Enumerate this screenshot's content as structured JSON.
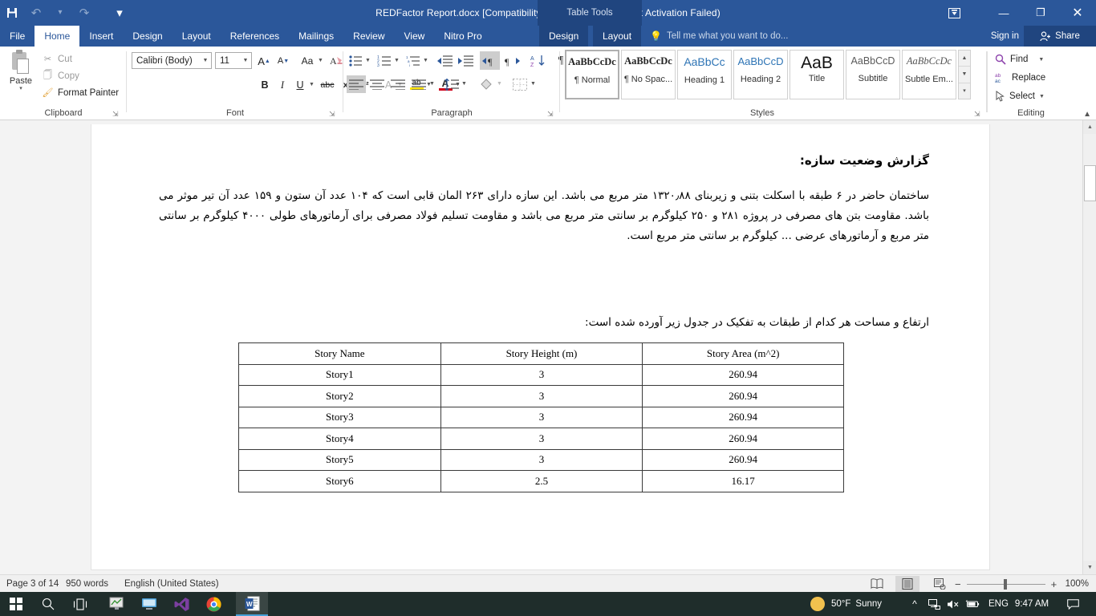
{
  "titlebar": {
    "document_title": "REDFactor Report.docx [Compatibility Mode] - Word (Product Activation Failed)",
    "contextual_tools": "Table Tools",
    "qat": [
      {
        "name": "save",
        "glyph": "💾"
      },
      {
        "name": "undo",
        "glyph": "↶"
      },
      {
        "name": "redo",
        "glyph": "↻"
      },
      {
        "name": "customize-qat",
        "glyph": "▾"
      }
    ],
    "window_controls": [
      {
        "name": "ribbon-display-options",
        "glyph": "⬜"
      },
      {
        "name": "minimize",
        "glyph": "─"
      },
      {
        "name": "restore",
        "glyph": "❐"
      },
      {
        "name": "close",
        "glyph": "✕"
      }
    ]
  },
  "tabs": [
    {
      "label": "File",
      "active": false
    },
    {
      "label": "Home",
      "active": true
    },
    {
      "label": "Insert",
      "active": false
    },
    {
      "label": "Design",
      "active": false
    },
    {
      "label": "Layout",
      "active": false
    },
    {
      "label": "References",
      "active": false
    },
    {
      "label": "Mailings",
      "active": false
    },
    {
      "label": "Review",
      "active": false
    },
    {
      "label": "View",
      "active": false
    },
    {
      "label": "Nitro Pro",
      "active": false
    }
  ],
  "contextual_tabs": [
    {
      "label": "Design"
    },
    {
      "label": "Layout"
    }
  ],
  "tell_me": {
    "placeholder": "Tell me what you want to do...",
    "icon": "lightbulb-icon"
  },
  "account": {
    "sign_in": "Sign in",
    "share": "Share"
  },
  "ribbon": {
    "groups": [
      {
        "name": "Clipboard"
      },
      {
        "name": "Font"
      },
      {
        "name": "Paragraph"
      },
      {
        "name": "Styles"
      },
      {
        "name": "Editing"
      }
    ],
    "clipboard": {
      "paste": "Paste",
      "cut": "Cut",
      "copy": "Copy",
      "format_painter": "Format Painter"
    },
    "font": {
      "font_name": "Calibri (Body)",
      "font_size": "11",
      "grow_font": "A",
      "shrink_font": "A",
      "change_case": "Aa",
      "clear_formatting": "✐",
      "bold": "B",
      "italic": "I",
      "underline": "U",
      "strikethrough": "abc",
      "subscript": "x₂",
      "superscript": "x²",
      "text_effects": "A",
      "highlight": "ab",
      "font_color": "A"
    },
    "paragraph": {
      "bullets": "☰",
      "numbering": "☰",
      "multilevel": "☰",
      "decrease_indent": "⇤",
      "increase_indent": "⇥",
      "ltr_text": "¶",
      "rtl_text": "¶",
      "sort": "A↓",
      "show_marks": "¶",
      "align_left": "☰",
      "align_center": "☰",
      "align_right": "☰",
      "justify": "☰",
      "line_spacing": "↕",
      "shading": "▣",
      "borders": "▦"
    },
    "styles": [
      {
        "preview": "AaBbCcDc",
        "name": "¶ Normal",
        "selected": true
      },
      {
        "preview": "AaBbCcDc",
        "name": "¶ No Spac...",
        "selected": false
      },
      {
        "preview": "AaBbCс",
        "name": "Heading 1",
        "selected": false
      },
      {
        "preview": "AaBbCcD",
        "name": "Heading 2",
        "selected": false
      },
      {
        "preview": "AaB",
        "name": "Title",
        "selected": false
      },
      {
        "preview": "AaBbCcD",
        "name": "Subtitle",
        "selected": false
      },
      {
        "preview": "AaBbCcDc",
        "name": "Subtle Em...",
        "selected": false
      }
    ],
    "editing": {
      "find": "Find",
      "replace": "Replace",
      "select": "Select"
    }
  },
  "document": {
    "heading": "گزارش وضعیت سازه:",
    "paragraph": "ساختمان حاضر در ۶ طبقه با اسکلت بتنی و زیربنای ۱۳۲۰٫۸۸ متر مربع می باشد. این سازه دارای ۲۶۳ المان قابی است که ۱۰۴ عدد آن ستون و ۱۵۹ عدد آن تیر موثر می باشد. مقاومت بتن های مصرفی در پروژه ۲۸۱ و ۲۵۰ کیلوگرم بر سانتی متر مربع می باشد و مقاومت تسلیم فولاد مصرفی برای آرماتورهای طولی ۴۰۰۰ کیلوگرم بر سانتی متر مربع و آرماتورهای عرضی ... کیلوگرم بر سانتی متر مربع است.",
    "table_intro": "ارتفاع و مساحت هر کدام از طبقات به تفکیک در جدول زیر آورده شده است:",
    "table": {
      "headers": [
        "Story Name",
        "Story Height (m)",
        "Story Area (m^2)"
      ],
      "rows": [
        [
          "Story1",
          "3",
          "260.94"
        ],
        [
          "Story2",
          "3",
          "260.94"
        ],
        [
          "Story3",
          "3",
          "260.94"
        ],
        [
          "Story4",
          "3",
          "260.94"
        ],
        [
          "Story5",
          "3",
          "260.94"
        ],
        [
          "Story6",
          "2.5",
          "16.17"
        ]
      ]
    }
  },
  "statusbar": {
    "page": "Page 3 of 14",
    "words": "950 words",
    "language": "English (United States)",
    "views": [
      {
        "name": "read-mode",
        "glyph": "📖",
        "selected": false
      },
      {
        "name": "print-layout",
        "glyph": "☰",
        "selected": true
      },
      {
        "name": "web-layout",
        "glyph": "▤",
        "selected": false
      }
    ],
    "zoom_out": "−",
    "zoom_in": "+",
    "zoom_level": "100%"
  },
  "taskbar": {
    "items": [
      {
        "name": "start",
        "glyph": ""
      },
      {
        "name": "search",
        "glyph": "🔍"
      },
      {
        "name": "task-view",
        "glyph": "⌸"
      },
      {
        "name": "etabs-app",
        "glyph": "🖼"
      },
      {
        "name": "remote-desktop",
        "glyph": "🖥"
      },
      {
        "name": "visual-studio",
        "glyph": "✖"
      },
      {
        "name": "google-chrome",
        "glyph": "◉"
      },
      {
        "name": "telegram",
        "glyph": "➤"
      },
      {
        "name": "word-active",
        "glyph": "W"
      }
    ],
    "weather_temp": "50°F",
    "weather_desc": "Sunny",
    "tray": [
      {
        "name": "show-hidden-icons",
        "glyph": "⌃"
      },
      {
        "name": "network",
        "glyph": "🖧"
      },
      {
        "name": "volume-muted",
        "glyph": "🔇"
      },
      {
        "name": "battery",
        "glyph": "🔋"
      }
    ],
    "language": "ENG",
    "clock": "9:47 AM",
    "action_center": "💬"
  },
  "colors": {
    "word_blue": "#2b579a",
    "word_blue_dark": "#20457f",
    "taskbar": "#1f2d2b"
  }
}
